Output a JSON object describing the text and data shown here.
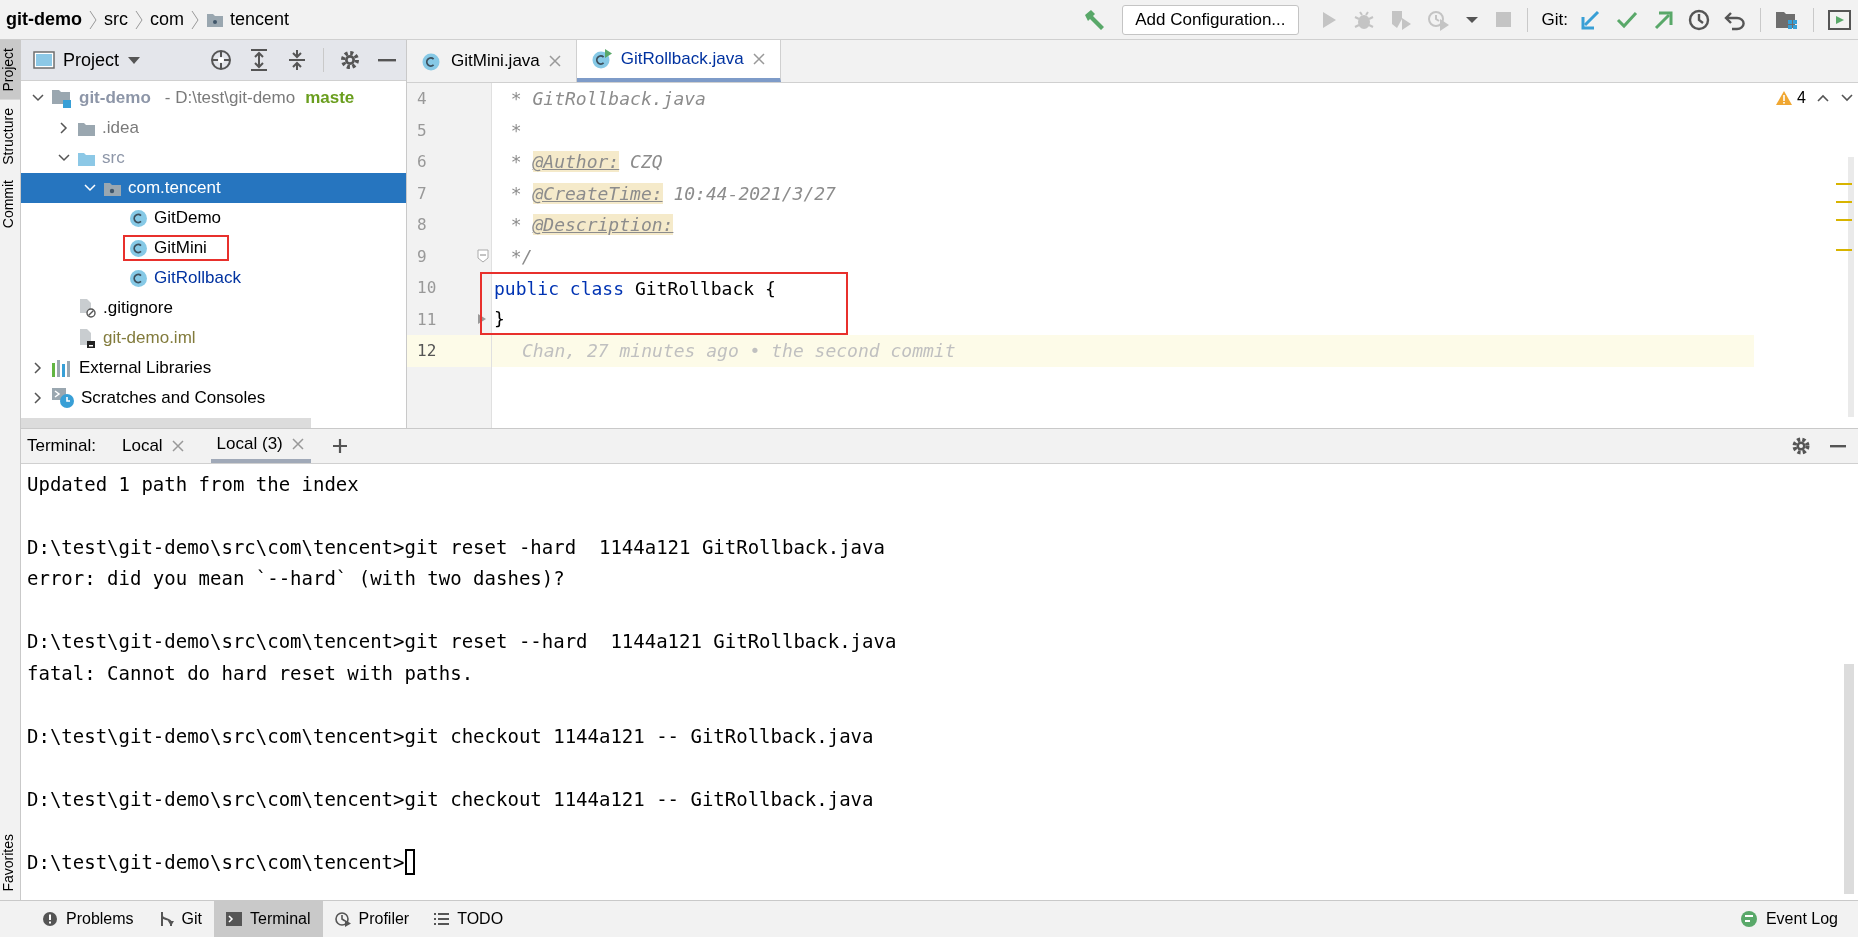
{
  "breadcrumbs": [
    {
      "label": "git-demo",
      "kind": "project"
    },
    {
      "label": "src",
      "kind": "plain"
    },
    {
      "label": "com",
      "kind": "plain"
    },
    {
      "label": "tencent",
      "kind": "package"
    }
  ],
  "toolbar": {
    "config_button": "Add Configuration...",
    "vcs_label": "Git:"
  },
  "left_strip": [
    {
      "label": "Project",
      "selected": true
    },
    {
      "label": "Structure",
      "selected": false
    },
    {
      "label": "Commit",
      "selected": false
    },
    {
      "label": "Favorites",
      "selected": false
    }
  ],
  "project_panel": {
    "title": "Project",
    "tree": [
      {
        "label": "git-demo",
        "kind": "module",
        "color": "#8d96a8",
        "expanded": true,
        "selected": false,
        "boxed": false,
        "path": " - D:\\test\\git-demo",
        "branch": "maste",
        "children": [
          {
            "label": ".idea",
            "kind": "folder",
            "color": "#7a7a7a",
            "expanded": false,
            "selected": false,
            "boxed": false
          },
          {
            "label": "src",
            "kind": "source-folder",
            "color": "#8d96a8",
            "expanded": true,
            "selected": false,
            "boxed": false,
            "children": [
              {
                "label": "com.tencent",
                "kind": "package",
                "color": "#ffffff",
                "expanded": true,
                "selected": true,
                "boxed": false,
                "children": [
                  {
                    "label": "GitDemo",
                    "kind": "class",
                    "color": "#000000",
                    "selected": false,
                    "boxed": false
                  },
                  {
                    "label": "GitMini",
                    "kind": "class",
                    "color": "#000000",
                    "selected": false,
                    "boxed": true
                  },
                  {
                    "label": "GitRollback",
                    "kind": "class",
                    "color": "#0032a0",
                    "selected": false,
                    "boxed": false
                  }
                ]
              }
            ]
          },
          {
            "label": ".gitignore",
            "kind": "ignore-file",
            "color": "#000000",
            "selected": false,
            "boxed": false
          },
          {
            "label": "git-demo.iml",
            "kind": "module-file",
            "color": "#827b3c",
            "selected": false,
            "boxed": false
          }
        ]
      },
      {
        "label": "External Libraries",
        "kind": "libraries",
        "color": "#000000",
        "expanded": false,
        "selected": false,
        "boxed": false
      },
      {
        "label": "Scratches and Consoles",
        "kind": "scratches",
        "color": "#000000",
        "expanded": false,
        "selected": false,
        "boxed": false
      }
    ]
  },
  "editor": {
    "tabs": [
      {
        "label": "GitMini.java",
        "selected": false,
        "modified": false
      },
      {
        "label": "GitRollback.java",
        "selected": true,
        "modified": true
      }
    ],
    "warnings": "4",
    "lines": [
      {
        "number": "4",
        "boxed": false,
        "current": false,
        "tokens": [
          {
            "text": " * GitRollback.java",
            "kind": "comment"
          }
        ]
      },
      {
        "number": "5",
        "boxed": false,
        "current": false,
        "tokens": [
          {
            "text": " *",
            "kind": "comment"
          }
        ]
      },
      {
        "number": "6",
        "boxed": false,
        "current": false,
        "tokens": [
          {
            "text": " * ",
            "kind": "comment"
          },
          {
            "text": "@Author:",
            "kind": "doc-tag"
          },
          {
            "text": " CZQ",
            "kind": "comment"
          }
        ]
      },
      {
        "number": "7",
        "boxed": false,
        "current": false,
        "tokens": [
          {
            "text": " * ",
            "kind": "comment"
          },
          {
            "text": "@CreateTime:",
            "kind": "doc-tag"
          },
          {
            "text": " 10:44-2021/3/27",
            "kind": "comment"
          }
        ]
      },
      {
        "number": "8",
        "boxed": false,
        "current": false,
        "tokens": [
          {
            "text": " * ",
            "kind": "comment"
          },
          {
            "text": "@Description:",
            "kind": "doc-tag"
          }
        ]
      },
      {
        "number": "9",
        "boxed": false,
        "current": false,
        "fold": true,
        "tokens": [
          {
            "text": " */",
            "kind": "comment"
          }
        ]
      },
      {
        "number": "10",
        "boxed": true,
        "current": false,
        "tokens": [
          {
            "text": "public class",
            "kind": "keyword"
          },
          {
            "text": " GitRollback ",
            "kind": "name"
          },
          {
            "text": "{",
            "kind": "plain"
          }
        ]
      },
      {
        "number": "11",
        "boxed": true,
        "current": false,
        "tokens": [
          {
            "text": "}",
            "kind": "plain"
          }
        ]
      },
      {
        "number": "12",
        "boxed": false,
        "current": true,
        "blame": "Chan, 27 minutes ago • the second commit"
      }
    ]
  },
  "terminal": {
    "title": "Terminal:",
    "tabs": [
      {
        "label": "Local",
        "selected": false
      },
      {
        "label": "Local (3)",
        "selected": true
      }
    ],
    "blocks": [
      [
        "Updated 1 path from the index"
      ],
      [
        "D:\\test\\git-demo\\src\\com\\tencent>git reset -hard  1144a121 GitRollback.java",
        "error: did you mean `--hard` (with two dashes)?"
      ],
      [
        "D:\\test\\git-demo\\src\\com\\tencent>git reset --hard  1144a121 GitRollback.java",
        "fatal: Cannot do hard reset with paths."
      ],
      [
        "D:\\test\\git-demo\\src\\com\\tencent>git checkout 1144a121 -- GitRollback.java"
      ],
      [
        "D:\\test\\git-demo\\src\\com\\tencent>git checkout 1144a121 -- GitRollback.java"
      ],
      [
        "D:\\test\\git-demo\\src\\com\\tencent>"
      ]
    ]
  },
  "bottom_tools": [
    {
      "label": "Problems",
      "kind": "problems",
      "selected": false
    },
    {
      "label": "Git",
      "kind": "git",
      "selected": false
    },
    {
      "label": "Terminal",
      "kind": "terminal",
      "selected": true
    },
    {
      "label": "Profiler",
      "kind": "profiler",
      "selected": false
    },
    {
      "label": "TODO",
      "kind": "todo",
      "selected": false
    }
  ],
  "event_log": "Event Log"
}
